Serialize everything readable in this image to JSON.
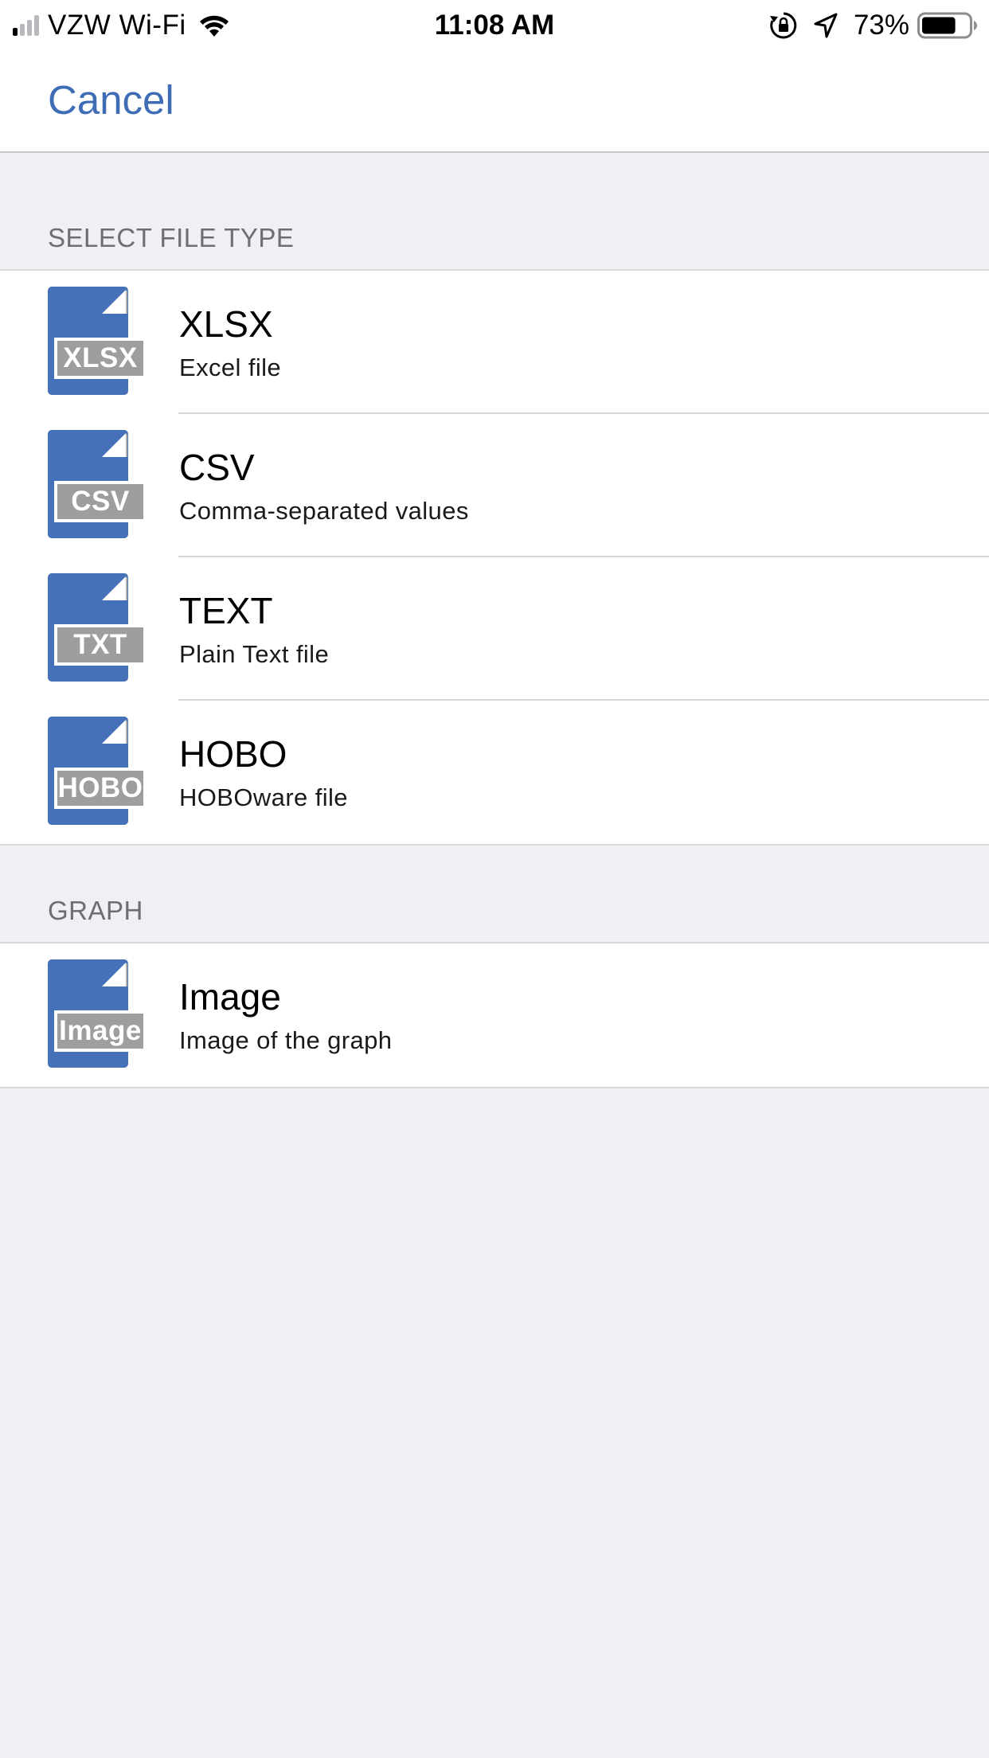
{
  "status_bar": {
    "carrier": "VZW Wi-Fi",
    "time": "11:08 AM",
    "battery_percent": "73%",
    "battery_level": 0.73,
    "signal_bars_filled": 1,
    "signal_bars_total": 4,
    "icons": [
      "cellular-signal-icon",
      "wifi-icon",
      "rotation-lock-icon",
      "location-arrow-icon",
      "battery-icon"
    ]
  },
  "nav": {
    "cancel_label": "Cancel"
  },
  "sections": [
    {
      "header": "SELECT FILE TYPE",
      "items": [
        {
          "icon_label": "XLSX",
          "title": "XLSX",
          "subtitle": "Excel file"
        },
        {
          "icon_label": "CSV",
          "title": "CSV",
          "subtitle": "Comma-separated values"
        },
        {
          "icon_label": "TXT",
          "title": "TEXT",
          "subtitle": "Plain Text file"
        },
        {
          "icon_label": "HOBO",
          "title": "HOBO",
          "subtitle": "HOBOware file"
        }
      ]
    },
    {
      "header": "GRAPH",
      "items": [
        {
          "icon_label": "Image",
          "title": "Image",
          "subtitle": "Image of the graph"
        }
      ]
    }
  ],
  "colors": {
    "accent": "#3f6db5",
    "file_icon_blue": "#4571b9",
    "file_icon_label_gray": "#9e9e9e",
    "background": "#efeff4",
    "section_header_text": "#6d6d72"
  }
}
